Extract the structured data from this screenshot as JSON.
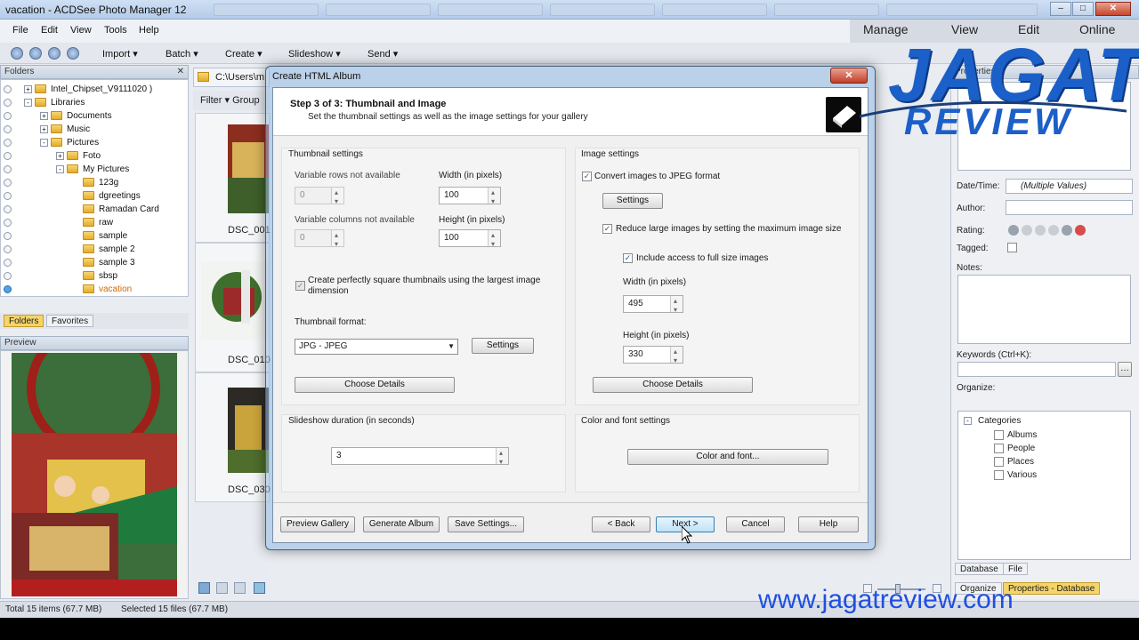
{
  "window": {
    "title": "vacation - ACDSee Photo Manager 12",
    "min": "–",
    "max": "□",
    "close": "✕"
  },
  "menu": [
    "File",
    "Edit",
    "View",
    "Tools",
    "Help"
  ],
  "modes": [
    "Manage",
    "View",
    "Edit",
    "Online"
  ],
  "toolbar": [
    "Import",
    "Batch",
    "Create",
    "Slideshow",
    "Send"
  ],
  "folders_panel": {
    "title": "Folders",
    "items": [
      {
        "label": "Intel_Chipset_V9111020 )",
        "depth": 0,
        "expander": "+"
      },
      {
        "label": "Libraries",
        "depth": 0,
        "expander": "-"
      },
      {
        "label": "Documents",
        "depth": 1,
        "expander": "+"
      },
      {
        "label": "Music",
        "depth": 1,
        "expander": "+"
      },
      {
        "label": "Pictures",
        "depth": 1,
        "expander": "-"
      },
      {
        "label": "Foto",
        "depth": 2,
        "expander": "+"
      },
      {
        "label": "My Pictures",
        "depth": 2,
        "expander": "-"
      },
      {
        "label": "123g",
        "depth": 3,
        "expander": ""
      },
      {
        "label": "dgreetings",
        "depth": 3,
        "expander": ""
      },
      {
        "label": "Ramadan Card",
        "depth": 3,
        "expander": ""
      },
      {
        "label": "raw",
        "depth": 3,
        "expander": ""
      },
      {
        "label": "sample",
        "depth": 3,
        "expander": ""
      },
      {
        "label": "sample 2",
        "depth": 3,
        "expander": ""
      },
      {
        "label": "sample 3",
        "depth": 3,
        "expander": ""
      },
      {
        "label": "sbsp",
        "depth": 3,
        "expander": ""
      },
      {
        "label": "vacation",
        "depth": 3,
        "expander": "",
        "selected": true
      }
    ],
    "tabs": [
      "Folders",
      "Favorites"
    ]
  },
  "preview_panel": {
    "title": "Preview"
  },
  "browser": {
    "path": "C:\\Users\\m",
    "filter": "Filter ▾  Group",
    "thumbs": [
      "DSC_001",
      "DSC_010",
      "DSC_030"
    ]
  },
  "properties": {
    "title": "Properties",
    "date_label": "Date/Time:",
    "date_value": "(Multiple Values)",
    "author_label": "Author:",
    "rating_label": "Rating:",
    "tagged_label": "Tagged:",
    "notes_label": "Notes:",
    "keywords_label": "Keywords (Ctrl+K):",
    "organize_label": "Organize:",
    "categories": "Categories",
    "category_items": [
      "Albums",
      "People",
      "Places",
      "Various"
    ],
    "tabs": [
      "Database",
      "File"
    ],
    "bottom_tabs": [
      "Organize",
      "Properties - Database"
    ]
  },
  "status": {
    "total": "Total 15 items  (67.7 MB)",
    "selected": "Selected 15 files (67.7 MB)"
  },
  "dialog": {
    "title": "Create HTML Album",
    "close": "✕",
    "step_title": "Step 3 of 3: Thumbnail and Image",
    "step_subtitle": "Set the thumbnail settings as well as the image settings for your gallery",
    "thumbnail": {
      "group_label": "Thumbnail settings",
      "rows_label": "Variable rows not available",
      "rows_value": "0",
      "cols_label": "Variable columns not available",
      "cols_value": "0",
      "width_label": "Width (in pixels)",
      "width_value": "100",
      "height_label": "Height (in pixels)",
      "height_value": "100",
      "square_label": "Create perfectly square thumbnails using the largest image dimension",
      "square_checked": true,
      "format_label": "Thumbnail format:",
      "format_value": "JPG - JPEG",
      "settings_btn": "Settings",
      "details_btn": "Choose Details"
    },
    "image": {
      "group_label": "Image settings",
      "convert_label": "Convert images to JPEG format",
      "convert_checked": true,
      "settings_btn": "Settings",
      "reduce_label": "Reduce large images by setting the maximum image size",
      "reduce_checked": true,
      "access_label": "Include access to full size images",
      "access_checked": true,
      "width_label": "Width (in pixels)",
      "width_value": "495",
      "height_label": "Height (in pixels)",
      "height_value": "330",
      "details_btn": "Choose Details"
    },
    "slideshow": {
      "group_label": "Slideshow duration (in seconds)",
      "value": "3"
    },
    "color": {
      "group_label": "Color and font settings",
      "btn": "Color and font..."
    },
    "footer": [
      "Preview Gallery",
      "Generate Album",
      "Save Settings...",
      "< Back",
      "Next >",
      "Cancel",
      "Help"
    ]
  },
  "watermark": {
    "brand_top": "JAGAT",
    "brand_bottom": "REVIEW",
    "url": "www.jagatreview.com"
  }
}
